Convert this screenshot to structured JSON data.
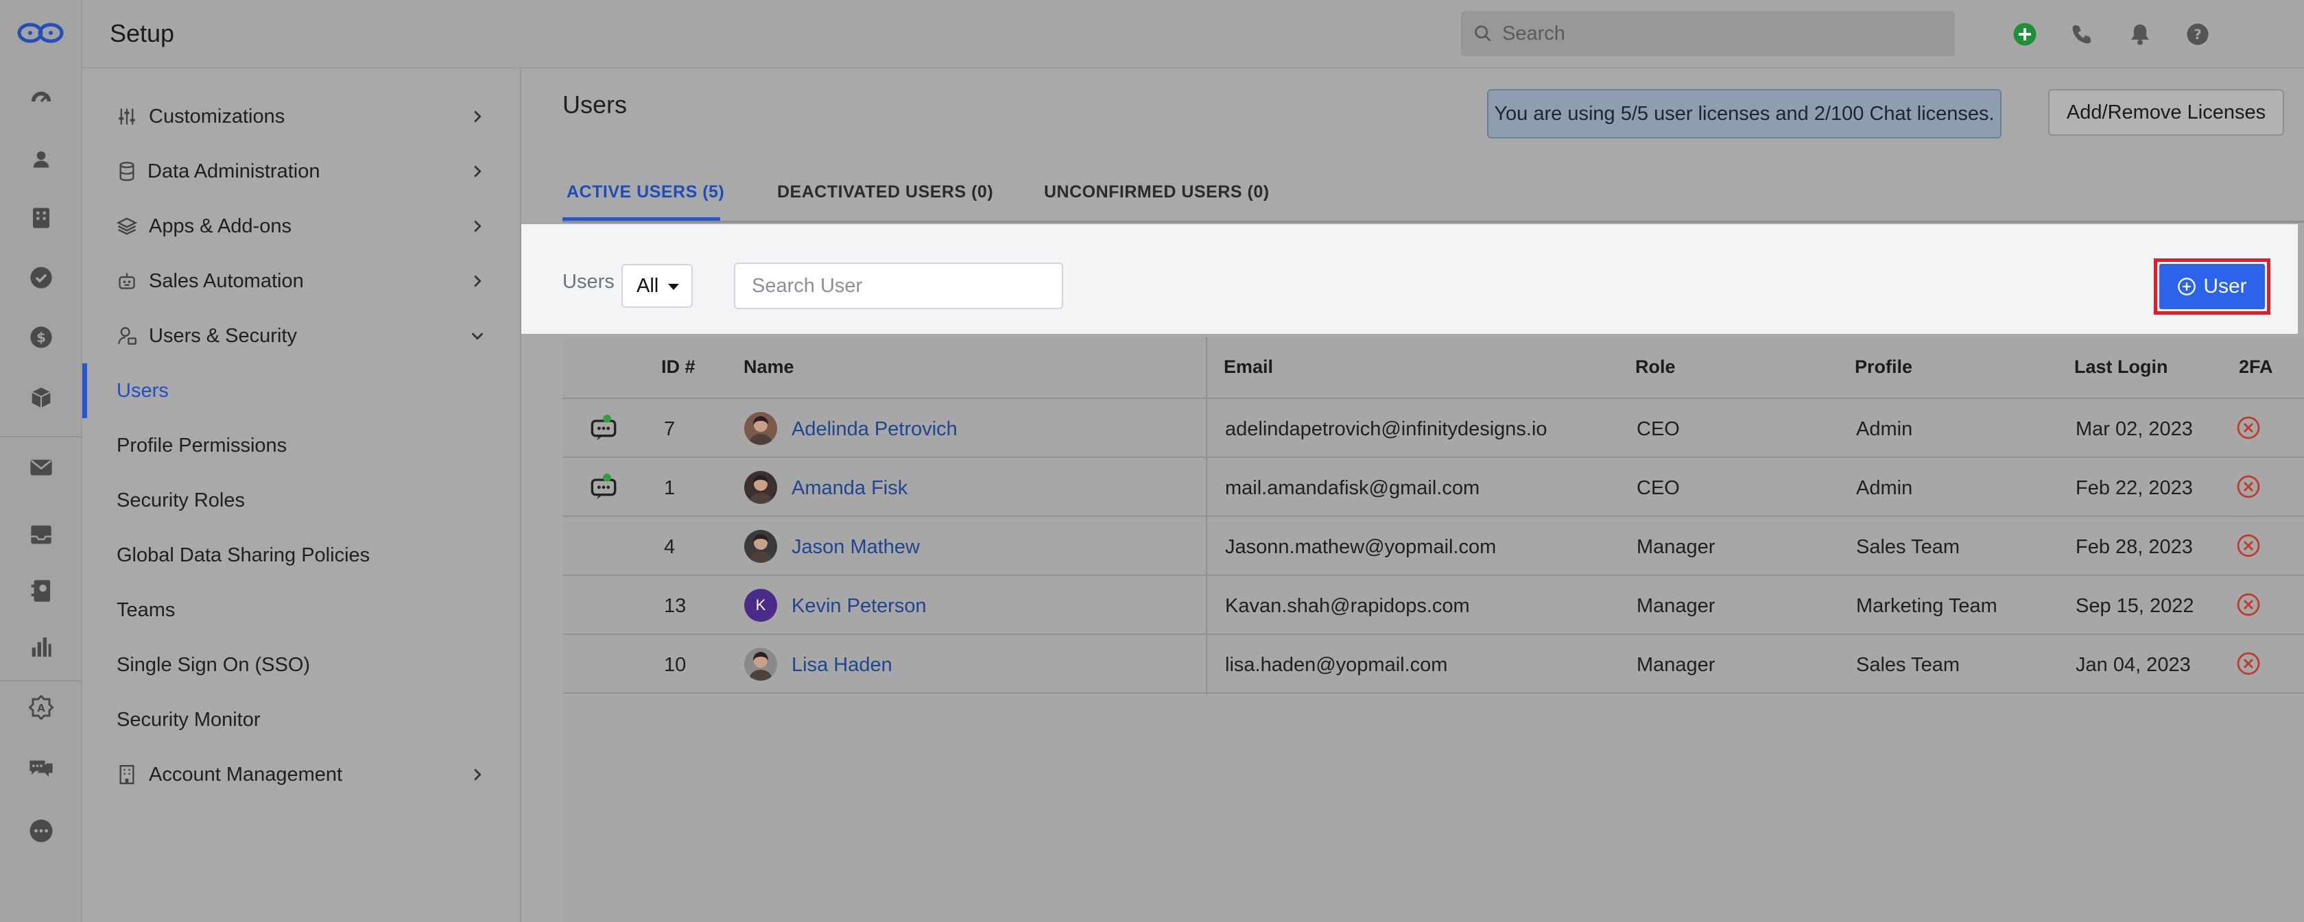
{
  "header": {
    "title": "Setup",
    "search_placeholder": "Search"
  },
  "sidebar": {
    "items": [
      {
        "label": "Customizations",
        "icon": "sliders-icon",
        "chevron": "right"
      },
      {
        "label": "Data Administration",
        "icon": "database-icon",
        "chevron": "right"
      },
      {
        "label": "Apps & Add-ons",
        "icon": "layers-icon",
        "chevron": "right"
      },
      {
        "label": "Sales Automation",
        "icon": "robot-icon",
        "chevron": "right"
      },
      {
        "label": "Users & Security",
        "icon": "user-lock-icon",
        "chevron": "down"
      },
      {
        "label": "Users",
        "active": true
      },
      {
        "label": "Profile Permissions"
      },
      {
        "label": "Security Roles"
      },
      {
        "label": "Global Data Sharing Policies"
      },
      {
        "label": "Teams"
      },
      {
        "label": "Single Sign On (SSO)"
      },
      {
        "label": "Security Monitor"
      },
      {
        "label": "Account Management",
        "icon": "building-icon",
        "chevron": "right"
      }
    ]
  },
  "main": {
    "title": "Users",
    "license_notice": "You are using 5/5 user licenses and 2/100 Chat licenses.",
    "licenses_button": "Add/Remove Licenses",
    "tabs": [
      {
        "label": "ACTIVE USERS (5)",
        "active": true
      },
      {
        "label": "DEACTIVATED USERS (0)"
      },
      {
        "label": "UNCONFIRMED USERS (0)"
      }
    ],
    "filter": {
      "label": "Users",
      "select_value": "All",
      "search_placeholder": "Search User",
      "add_button": "User"
    },
    "table": {
      "columns": [
        "ID #",
        "Name",
        "Email",
        "Role",
        "Profile",
        "Last Login",
        "2FA"
      ],
      "rows": [
        {
          "chat": true,
          "id": "7",
          "name": "Adelinda Petrovich",
          "email": "adelindapetrovich@infinitydesigns.io",
          "role": "CEO",
          "profile": "Admin",
          "last_login": "Mar 02, 2023",
          "avatar": "photo",
          "avatar_color": "#7b5a4a"
        },
        {
          "chat": true,
          "id": "1",
          "name": "Amanda Fisk",
          "email": "mail.amandafisk@gmail.com",
          "role": "CEO",
          "profile": "Admin",
          "last_login": "Feb 22, 2023",
          "avatar": "photo",
          "avatar_color": "#3b3030"
        },
        {
          "chat": false,
          "id": "4",
          "name": "Jason Mathew",
          "email": "Jasonn.mathew@yopmail.com",
          "role": "Manager",
          "profile": "Sales Team",
          "last_login": "Feb 28, 2023",
          "avatar": "photo",
          "avatar_color": "#3a3a3a"
        },
        {
          "chat": false,
          "id": "13",
          "name": "Kevin Peterson",
          "email": "Kavan.shah@rapidops.com",
          "role": "Manager",
          "profile": "Marketing Team",
          "last_login": "Sep 15, 2022",
          "avatar": "initial",
          "initial": "K",
          "avatar_color": "#4b2a8a"
        },
        {
          "chat": false,
          "id": "10",
          "name": "Lisa Haden",
          "email": "lisa.haden@yopmail.com",
          "role": "Manager",
          "profile": "Sales Team",
          "last_login": "Jan 04, 2023",
          "avatar": "photo",
          "avatar_color": "#8a8a8a"
        }
      ]
    }
  },
  "colors": {
    "accent": "#2456d3",
    "add_button": "#2b63ea",
    "highlight_border": "#e11d2a",
    "link": "#1e4690",
    "disabled_2fa": "#c0392b",
    "online": "#2ea043"
  }
}
